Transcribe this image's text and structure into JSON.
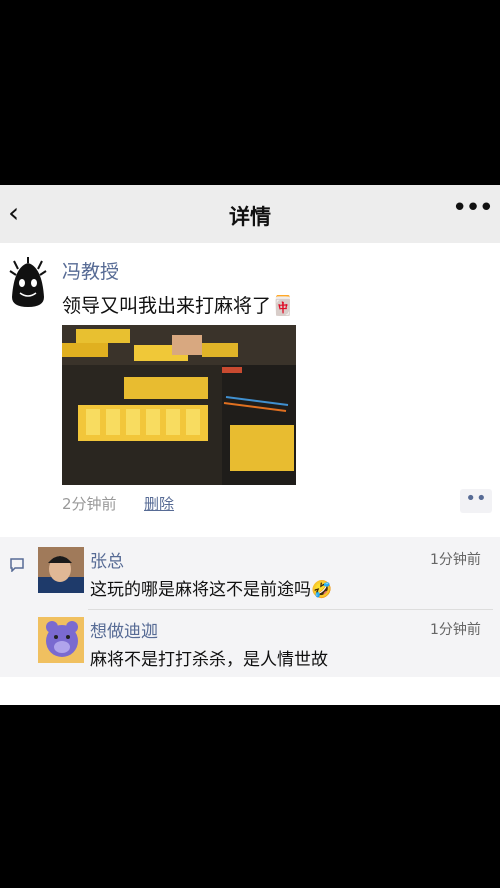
{
  "header": {
    "title": "详情",
    "back_icon": "chevron-left-icon",
    "more_icon": "more-dots-icon"
  },
  "post": {
    "author": "冯教授",
    "text": "领导又叫我出来打麻将了",
    "emoji": "🀄",
    "time": "2分钟前",
    "delete_label": "删除",
    "more_label": "••"
  },
  "comments": [
    {
      "author": "张总",
      "time": "1分钟前",
      "text": "这玩的哪是麻将这不是前途吗",
      "emoji": "🤣"
    },
    {
      "author": "想做迪迦",
      "time": "1分钟前",
      "text": "麻将不是打打杀杀，是人情世故"
    }
  ]
}
